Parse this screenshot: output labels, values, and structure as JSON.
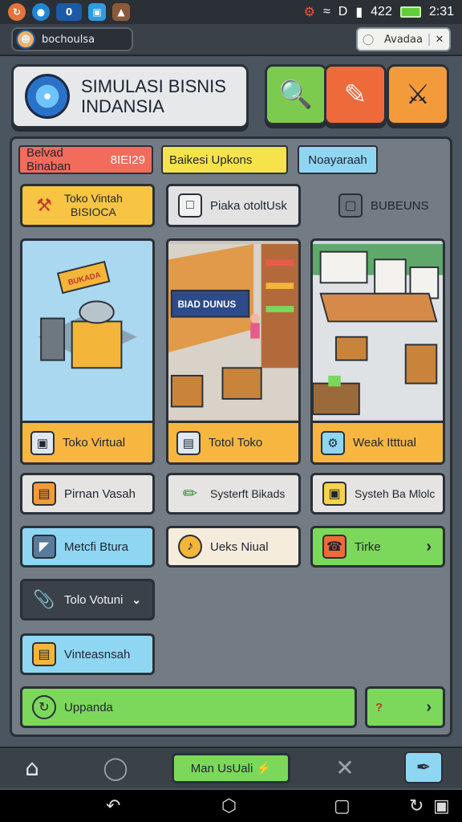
{
  "status_bar": {
    "time": "2:31",
    "battery_text": "422",
    "indicator_D": "D",
    "left_icons": [
      "sync-icon",
      "camera-icon",
      "app-icon",
      "photos-icon",
      "gallery-icon"
    ],
    "app_badge": "0"
  },
  "app_bar": {
    "username": "bochoulsa",
    "search_label": "Avadaa"
  },
  "header": {
    "title_line1": "SIMULASI BISNIS",
    "title_line2": "INDANSIA",
    "buttons": [
      {
        "icon": "magnifier-icon",
        "color": "#7ccb4f"
      },
      {
        "icon": "paint-tools-icon",
        "color": "#ef6a3a"
      },
      {
        "icon": "crossed-tools-icon",
        "color": "#f39a3a"
      }
    ]
  },
  "tabs": [
    {
      "label": "Belvad Binaban",
      "badge": "8IEI29",
      "color": "#f26b5b"
    },
    {
      "label": "Baikesi Upkons",
      "color": "#f6e24a"
    },
    {
      "label": "Noayaraah",
      "color": "#8fd6f2"
    }
  ],
  "row1": [
    {
      "label_line1": "Toko Vintah",
      "label_line2": "BISIOCA",
      "color": "#f7c443"
    },
    {
      "label": "Piaka otoltUsk",
      "color": "#e2e2e2"
    },
    {
      "label": "BUBEUNS"
    }
  ],
  "scenes": [
    {
      "label": "Toko Virtual",
      "sign": "BUKADA"
    },
    {
      "label": "Totol Toko",
      "sign": "BIAD DUNUS"
    },
    {
      "label": "Weak Itttual"
    }
  ],
  "grid": [
    {
      "label": "Pirnan Vasah",
      "color": "#e6e4e2"
    },
    {
      "label": "Systerft Bikads",
      "color": "#e6e4e2"
    },
    {
      "label": "Systeh Ba Mlolc",
      "color": "#e6e4e2"
    },
    {
      "label": "Metcfi Btura",
      "color": "#8fd6f2"
    },
    {
      "label": "Ueks Niual",
      "color": "#f5ecdc"
    },
    {
      "label": "Tirke",
      "color": "#7cd85a"
    },
    {
      "label": "Tolo Votuni",
      "color": "#3a4149"
    },
    {
      "label": "Vinteasnsah",
      "color": "#8fd6f2"
    }
  ],
  "bottom_actions": {
    "upgrade_label": "Uppanda",
    "question_label": "?"
  },
  "bottom_nav": {
    "main_button_label": "Man UsUali"
  }
}
